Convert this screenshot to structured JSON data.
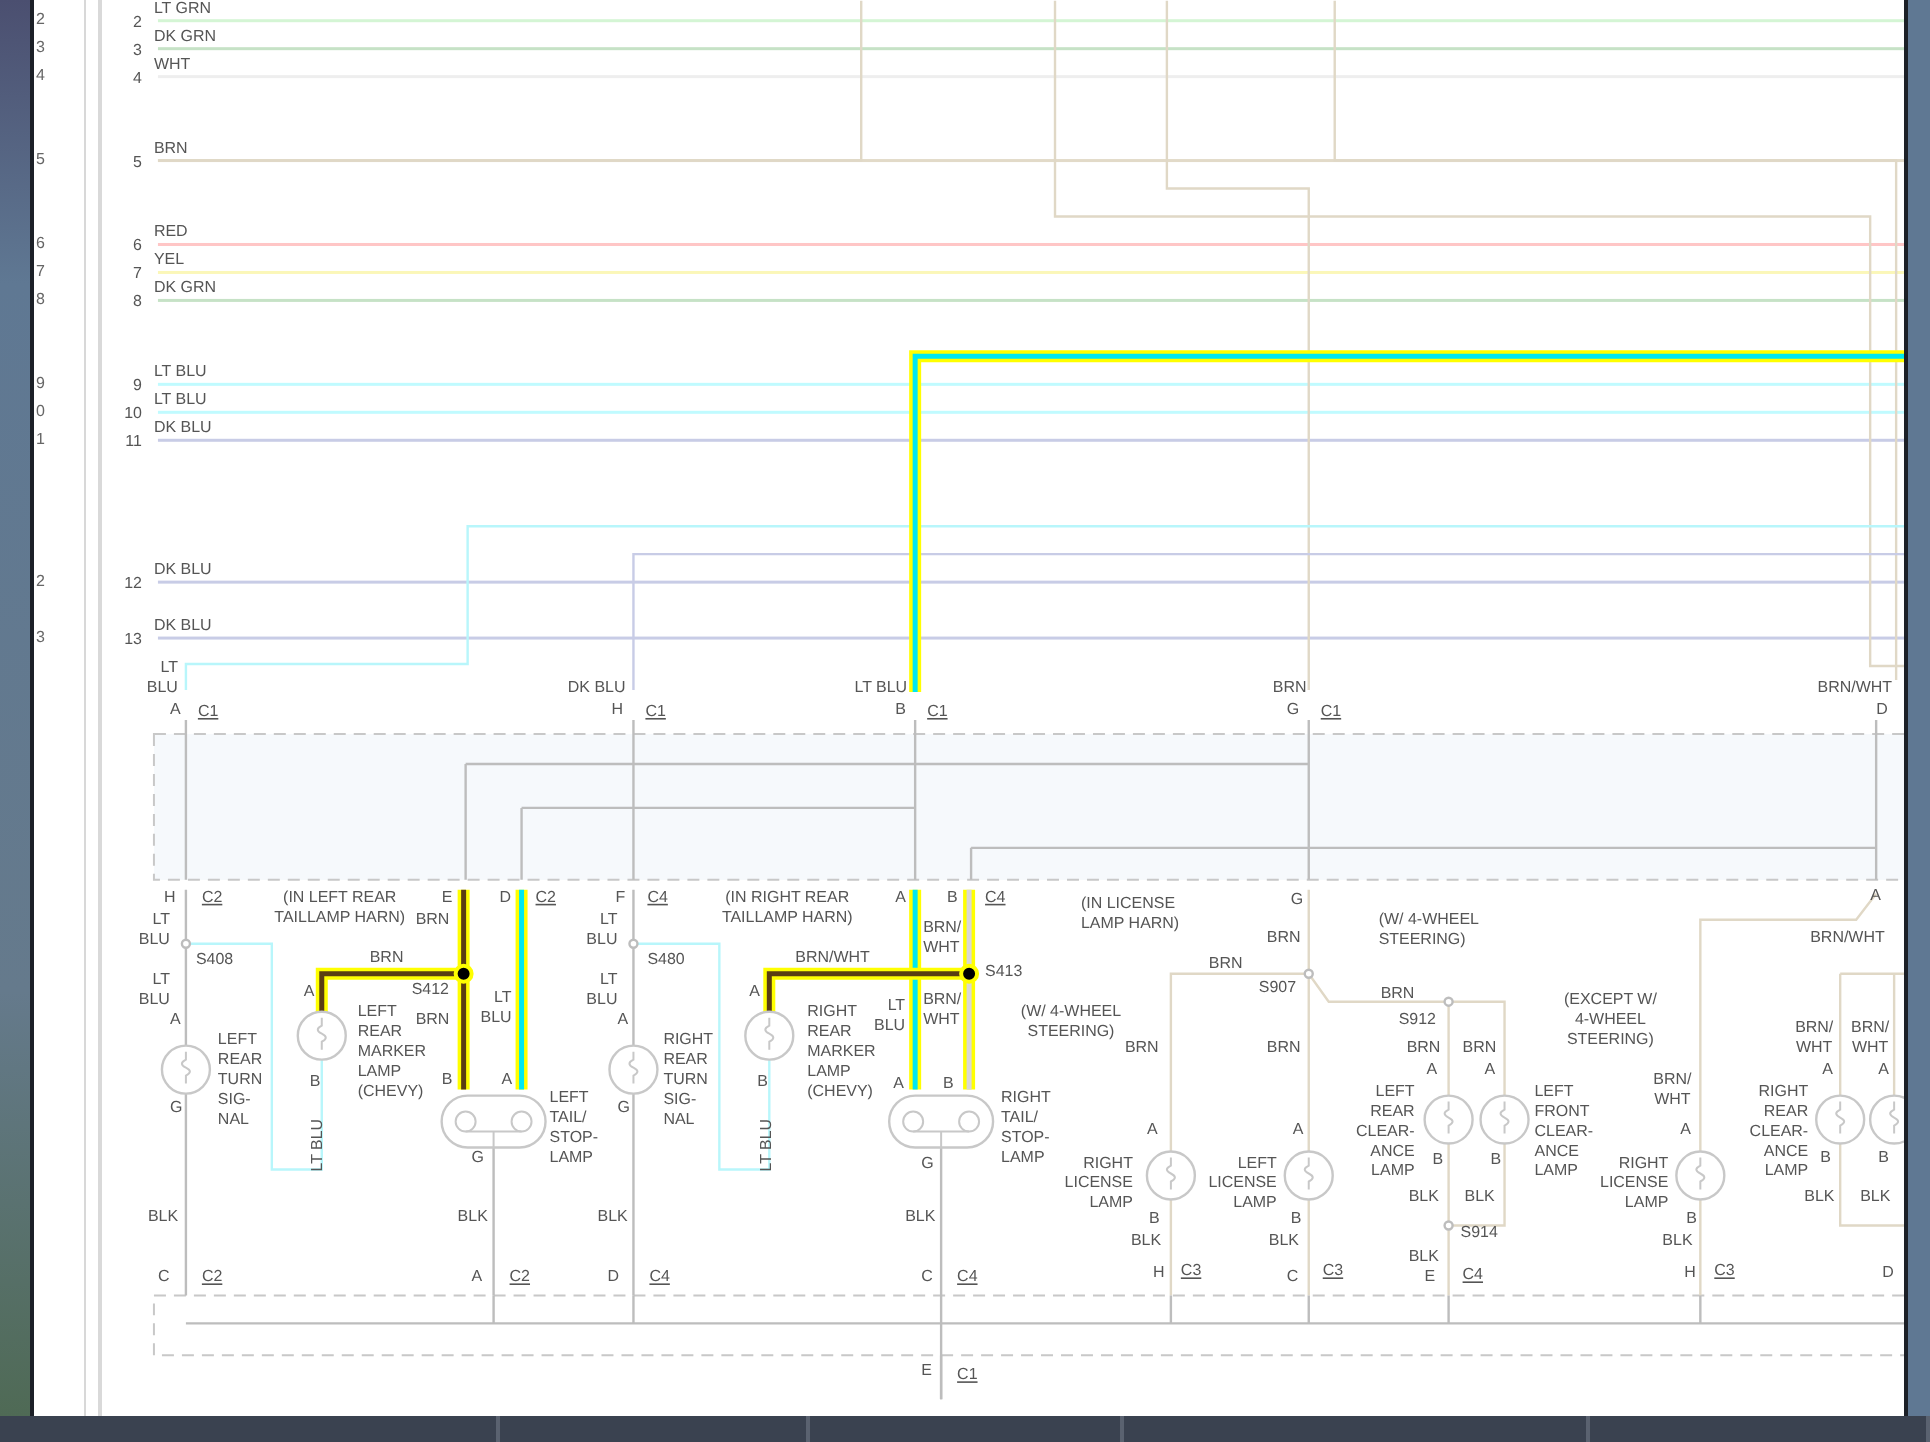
{
  "gutter_numbers": [
    "2",
    "3",
    "4",
    "5",
    "6",
    "7",
    "8",
    "9",
    "0",
    "1",
    "2",
    "3"
  ],
  "bus_rows": [
    {
      "number": "2",
      "label": "LT GRN",
      "color": "#d4f5d4"
    },
    {
      "number": "3",
      "label": "DK GRN",
      "color": "#c6e2c6"
    },
    {
      "number": "4",
      "label": "WHT",
      "color": "#eeeeee"
    },
    {
      "number": "5",
      "label": "BRN",
      "color": "#e2dac8"
    },
    {
      "number": "6",
      "label": "RED",
      "color": "#ffc6c6"
    },
    {
      "number": "7",
      "label": "YEL",
      "color": "#fbf7b8"
    },
    {
      "number": "8",
      "label": "DK GRN",
      "color": "#c6e2c6"
    },
    {
      "number": "9",
      "label": "LT BLU",
      "color": "#c0fbff"
    },
    {
      "number": "10",
      "label": "LT BLU",
      "color": "#c0fbff"
    },
    {
      "number": "11",
      "label": "DK BLU",
      "color": "#c8cce6"
    },
    {
      "number": "12",
      "label": "DK BLU",
      "color": "#c8cce6"
    },
    {
      "number": "13",
      "label": "DK BLU",
      "color": "#c8cce6"
    }
  ],
  "labels": [
    {
      "kind": "note",
      "lines": [
        "LT",
        "BLU"
      ]
    },
    {
      "kind": "note",
      "lines": [
        "A"
      ]
    },
    {
      "kind": "connector",
      "lines": [
        "C1"
      ]
    },
    {
      "kind": "note",
      "lines": [
        "DK BLU"
      ]
    },
    {
      "kind": "note",
      "lines": [
        "H"
      ]
    },
    {
      "kind": "connector",
      "lines": [
        "C1"
      ]
    },
    {
      "kind": "note",
      "lines": [
        "LT BLU"
      ]
    },
    {
      "kind": "note",
      "lines": [
        "B"
      ]
    },
    {
      "kind": "connector",
      "lines": [
        "C1"
      ]
    },
    {
      "kind": "note",
      "lines": [
        "BRN"
      ]
    },
    {
      "kind": "note",
      "lines": [
        "G"
      ]
    },
    {
      "kind": "connector",
      "lines": [
        "C1"
      ]
    },
    {
      "kind": "note",
      "lines": [
        "BRN/WHT"
      ]
    },
    {
      "kind": "note",
      "lines": [
        "D"
      ]
    },
    {
      "kind": "note",
      "lines": [
        "H"
      ]
    },
    {
      "kind": "connector",
      "lines": [
        "C2"
      ]
    },
    {
      "kind": "note",
      "lines": [
        "(IN LEFT REAR",
        "TAILLAMP HARN)"
      ]
    },
    {
      "kind": "note",
      "lines": [
        "E"
      ]
    },
    {
      "kind": "note",
      "lines": [
        "BRN"
      ]
    },
    {
      "kind": "note",
      "lines": [
        "D"
      ]
    },
    {
      "kind": "connector",
      "lines": [
        "C2"
      ]
    },
    {
      "kind": "note",
      "lines": [
        "LT",
        "BLU"
      ]
    },
    {
      "kind": "note",
      "lines": [
        "S408"
      ]
    },
    {
      "kind": "note",
      "lines": [
        "LT",
        "BLU"
      ]
    },
    {
      "kind": "note",
      "lines": [
        "A"
      ]
    },
    {
      "kind": "note",
      "lines": [
        "LEFT",
        "REAR",
        "TURN",
        "SIG-",
        "NAL"
      ]
    },
    {
      "kind": "note",
      "lines": [
        "G"
      ]
    },
    {
      "kind": "note",
      "lines": [
        "BRN"
      ]
    },
    {
      "kind": "note",
      "lines": [
        "A"
      ]
    },
    {
      "kind": "note",
      "lines": [
        "S412"
      ]
    },
    {
      "kind": "note",
      "lines": [
        "LEFT",
        "REAR",
        "MARKER",
        "LAMP",
        "(CHEVY)"
      ]
    },
    {
      "kind": "note",
      "lines": [
        "BRN"
      ]
    },
    {
      "kind": "note",
      "lines": [
        "LT",
        "BLU"
      ]
    },
    {
      "kind": "note",
      "lines": [
        "B"
      ]
    },
    {
      "kind": "vertical",
      "lines": [
        "LT BLU"
      ]
    },
    {
      "kind": "note",
      "lines": [
        "B"
      ]
    },
    {
      "kind": "note",
      "lines": [
        "A"
      ]
    },
    {
      "kind": "note",
      "lines": [
        "G"
      ]
    },
    {
      "kind": "note",
      "lines": [
        "LEFT",
        "TAIL/",
        "STOP-",
        "LAMP"
      ]
    },
    {
      "kind": "note",
      "lines": [
        "BLK"
      ]
    },
    {
      "kind": "note",
      "lines": [
        "BLK"
      ]
    },
    {
      "kind": "note",
      "lines": [
        "BLK"
      ]
    },
    {
      "kind": "note",
      "lines": [
        "BLK"
      ]
    },
    {
      "kind": "note",
      "lines": [
        "C"
      ]
    },
    {
      "kind": "connector",
      "lines": [
        "C2"
      ]
    },
    {
      "kind": "note",
      "lines": [
        "A"
      ]
    },
    {
      "kind": "connector",
      "lines": [
        "C2"
      ]
    },
    {
      "kind": "note",
      "lines": [
        "D"
      ]
    },
    {
      "kind": "connector",
      "lines": [
        "C4"
      ]
    },
    {
      "kind": "note",
      "lines": [
        "C"
      ]
    },
    {
      "kind": "connector",
      "lines": [
        "C4"
      ]
    },
    {
      "kind": "note",
      "lines": [
        "E"
      ]
    },
    {
      "kind": "connector",
      "lines": [
        "C1"
      ]
    },
    {
      "kind": "note",
      "lines": [
        "F"
      ]
    },
    {
      "kind": "connector",
      "lines": [
        "C4"
      ]
    },
    {
      "kind": "note",
      "lines": [
        "(IN RIGHT REAR",
        "TAILLAMP HARN)"
      ]
    },
    {
      "kind": "note",
      "lines": [
        "LT",
        "BLU"
      ]
    },
    {
      "kind": "note",
      "lines": [
        "S480"
      ]
    },
    {
      "kind": "note",
      "lines": [
        "LT",
        "BLU"
      ]
    },
    {
      "kind": "note",
      "lines": [
        "A"
      ]
    },
    {
      "kind": "note",
      "lines": [
        "RIGHT",
        "REAR",
        "TURN",
        "SIG-",
        "NAL"
      ]
    },
    {
      "kind": "note",
      "lines": [
        "G"
      ]
    },
    {
      "kind": "note",
      "lines": [
        "BRN/WHT"
      ]
    },
    {
      "kind": "note",
      "lines": [
        "A"
      ]
    },
    {
      "kind": "note",
      "lines": [
        "RIGHT",
        "REAR",
        "MARKER",
        "LAMP",
        "(CHEVY)"
      ]
    },
    {
      "kind": "note",
      "lines": [
        "B"
      ]
    },
    {
      "kind": "vertical",
      "lines": [
        "LT BLU"
      ]
    },
    {
      "kind": "note",
      "lines": [
        "A"
      ]
    },
    {
      "kind": "note",
      "lines": [
        "B"
      ]
    },
    {
      "kind": "connector",
      "lines": [
        "C4"
      ]
    },
    {
      "kind": "note",
      "lines": [
        "BRN/",
        "WHT"
      ]
    },
    {
      "kind": "note",
      "lines": [
        "S413"
      ]
    },
    {
      "kind": "note",
      "lines": [
        "LT",
        "BLU"
      ]
    },
    {
      "kind": "note",
      "lines": [
        "BRN/",
        "WHT"
      ]
    },
    {
      "kind": "note",
      "lines": [
        "A"
      ]
    },
    {
      "kind": "note",
      "lines": [
        "B"
      ]
    },
    {
      "kind": "note",
      "lines": [
        "G"
      ]
    },
    {
      "kind": "note",
      "lines": [
        "RIGHT",
        "TAIL/",
        "STOP-",
        "LAMP"
      ]
    },
    {
      "kind": "note",
      "lines": [
        "(IN LICENSE",
        "LAMP HARN)"
      ]
    },
    {
      "kind": "note",
      "lines": [
        "G"
      ]
    },
    {
      "kind": "note",
      "lines": [
        "BRN"
      ]
    },
    {
      "kind": "note",
      "lines": [
        "(W/ 4-WHEEL",
        "STEERING)"
      ]
    },
    {
      "kind": "note",
      "lines": [
        "BRN"
      ]
    },
    {
      "kind": "note",
      "lines": [
        "S907"
      ]
    },
    {
      "kind": "note",
      "lines": [
        "BRN"
      ]
    },
    {
      "kind": "note",
      "lines": [
        "(W/ 4-WHEEL",
        "STEERING)"
      ]
    },
    {
      "kind": "note",
      "lines": [
        "S912"
      ]
    },
    {
      "kind": "note",
      "lines": [
        "BRN"
      ]
    },
    {
      "kind": "note",
      "lines": [
        "BRN"
      ]
    },
    {
      "kind": "note",
      "lines": [
        "BRN"
      ]
    },
    {
      "kind": "note",
      "lines": [
        "BRN"
      ]
    },
    {
      "kind": "note",
      "lines": [
        "(EXCEPT W/",
        "4-WHEEL",
        "STEERING)"
      ]
    },
    {
      "kind": "note",
      "lines": [
        "A"
      ]
    },
    {
      "kind": "note",
      "lines": [
        "BRN/WHT"
      ]
    },
    {
      "kind": "note",
      "lines": [
        "A"
      ]
    },
    {
      "kind": "note",
      "lines": [
        "A"
      ]
    },
    {
      "kind": "note",
      "lines": [
        "LEFT",
        "REAR",
        "CLEAR-",
        "ANCE",
        "LAMP"
      ]
    },
    {
      "kind": "note",
      "lines": [
        "LEFT",
        "FRONT",
        "CLEAR-",
        "ANCE",
        "LAMP"
      ]
    },
    {
      "kind": "note",
      "lines": [
        "BRN/",
        "WHT"
      ]
    },
    {
      "kind": "note",
      "lines": [
        "BRN/",
        "WHT"
      ]
    },
    {
      "kind": "note",
      "lines": [
        "BRN/",
        "WHT"
      ]
    },
    {
      "kind": "note",
      "lines": [
        "A"
      ]
    },
    {
      "kind": "note",
      "lines": [
        "A"
      ]
    },
    {
      "kind": "note",
      "lines": [
        "A"
      ]
    },
    {
      "kind": "note",
      "lines": [
        "A"
      ]
    },
    {
      "kind": "note",
      "lines": [
        "A"
      ]
    },
    {
      "kind": "note",
      "lines": [
        "RIGHT",
        "LICENSE",
        "LAMP"
      ]
    },
    {
      "kind": "note",
      "lines": [
        "LEFT",
        "LICENSE",
        "LAMP"
      ]
    },
    {
      "kind": "note",
      "lines": [
        "RIGHT",
        "LICENSE",
        "LAMP"
      ]
    },
    {
      "kind": "note",
      "lines": [
        "RIGHT",
        "REAR",
        "CLEAR-",
        "ANCE",
        "LAMP"
      ]
    },
    {
      "kind": "note",
      "lines": [
        "B"
      ]
    },
    {
      "kind": "note",
      "lines": [
        "B"
      ]
    },
    {
      "kind": "note",
      "lines": [
        "B"
      ]
    },
    {
      "kind": "note",
      "lines": [
        "B"
      ]
    },
    {
      "kind": "note",
      "lines": [
        "B"
      ]
    },
    {
      "kind": "note",
      "lines": [
        "B"
      ]
    },
    {
      "kind": "note",
      "lines": [
        "B"
      ]
    },
    {
      "kind": "note",
      "lines": [
        "BLK"
      ]
    },
    {
      "kind": "note",
      "lines": [
        "BLK"
      ]
    },
    {
      "kind": "note",
      "lines": [
        "BLK"
      ]
    },
    {
      "kind": "note",
      "lines": [
        "BLK"
      ]
    },
    {
      "kind": "note",
      "lines": [
        "BLK"
      ]
    },
    {
      "kind": "note",
      "lines": [
        "BLK"
      ]
    },
    {
      "kind": "note",
      "lines": [
        "BLK"
      ]
    },
    {
      "kind": "note",
      "lines": [
        "S914"
      ]
    },
    {
      "kind": "note",
      "lines": [
        "BLK"
      ]
    },
    {
      "kind": "note",
      "lines": [
        "H"
      ]
    },
    {
      "kind": "connector",
      "lines": [
        "C3"
      ]
    },
    {
      "kind": "note",
      "lines": [
        "C"
      ]
    },
    {
      "kind": "connector",
      "lines": [
        "C3"
      ]
    },
    {
      "kind": "note",
      "lines": [
        "E"
      ]
    },
    {
      "kind": "connector",
      "lines": [
        "C4"
      ]
    },
    {
      "kind": "note",
      "lines": [
        "H"
      ]
    },
    {
      "kind": "connector",
      "lines": [
        "C3"
      ]
    },
    {
      "kind": "note",
      "lines": [
        "D"
      ]
    }
  ]
}
